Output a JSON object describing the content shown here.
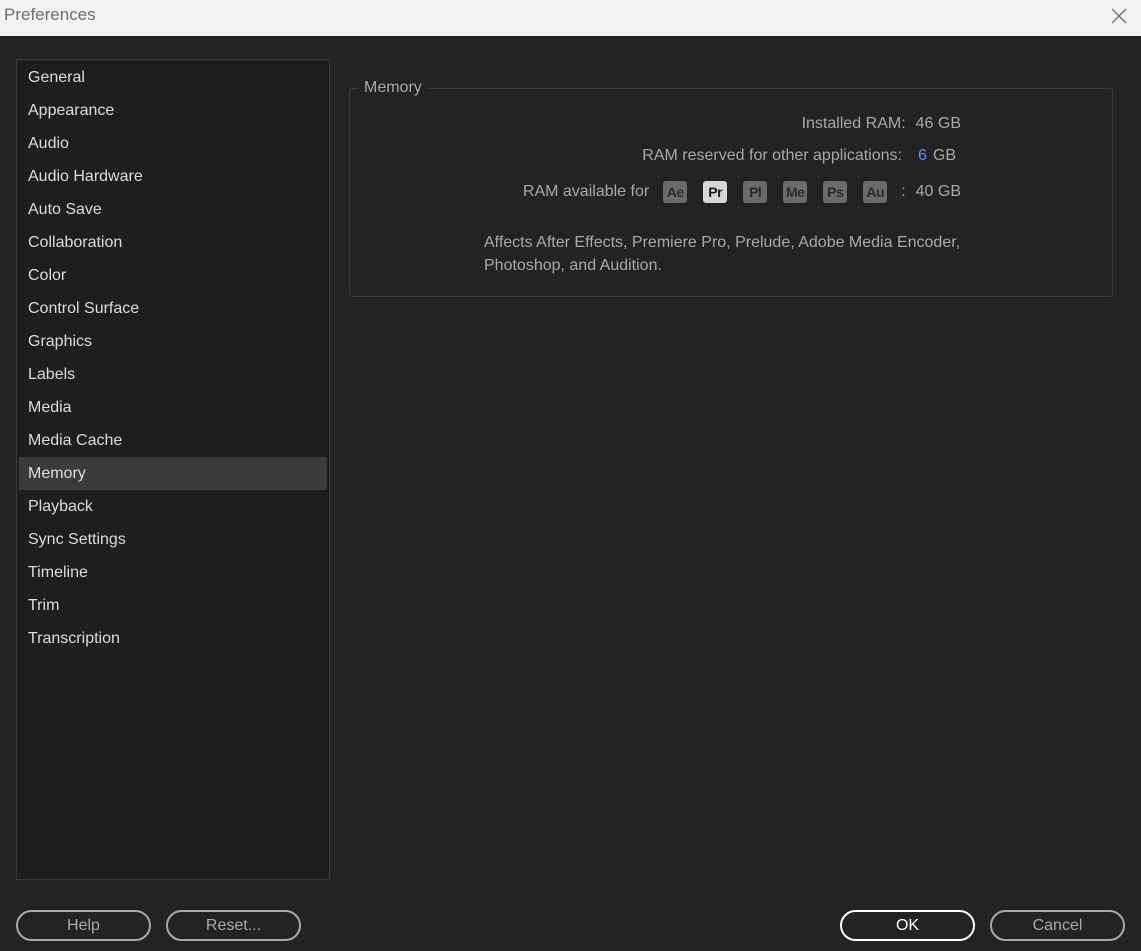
{
  "window": {
    "title": "Preferences"
  },
  "sidebar": {
    "items": [
      {
        "label": "General"
      },
      {
        "label": "Appearance"
      },
      {
        "label": "Audio"
      },
      {
        "label": "Audio Hardware"
      },
      {
        "label": "Auto Save"
      },
      {
        "label": "Collaboration"
      },
      {
        "label": "Color"
      },
      {
        "label": "Control Surface"
      },
      {
        "label": "Graphics"
      },
      {
        "label": "Labels"
      },
      {
        "label": "Media"
      },
      {
        "label": "Media Cache"
      },
      {
        "label": "Memory"
      },
      {
        "label": "Playback"
      },
      {
        "label": "Sync Settings"
      },
      {
        "label": "Timeline"
      },
      {
        "label": "Trim"
      },
      {
        "label": "Transcription"
      }
    ],
    "selected": "Memory"
  },
  "memory": {
    "heading": "Memory",
    "installed_label": "Installed RAM:",
    "installed_value": "46 GB",
    "reserved_label": "RAM reserved for other applications:",
    "reserved_value": "6",
    "reserved_unit": "GB",
    "available_label": "RAM available for",
    "apps": [
      "Ae",
      "Pr",
      "Pl",
      "Me",
      "Ps",
      "Au"
    ],
    "active_app": "Pr",
    "colon": ":",
    "available_value": "40 GB",
    "note": "Affects After Effects, Premiere Pro, Prelude, Adobe Media Encoder, Photoshop, and Audition."
  },
  "buttons": {
    "help": "Help",
    "reset": "Reset...",
    "ok": "OK",
    "cancel": "Cancel"
  },
  "colors": {
    "accent_link": "#4a9ff5",
    "background": "#232323",
    "selection": "#3b3b3b"
  }
}
